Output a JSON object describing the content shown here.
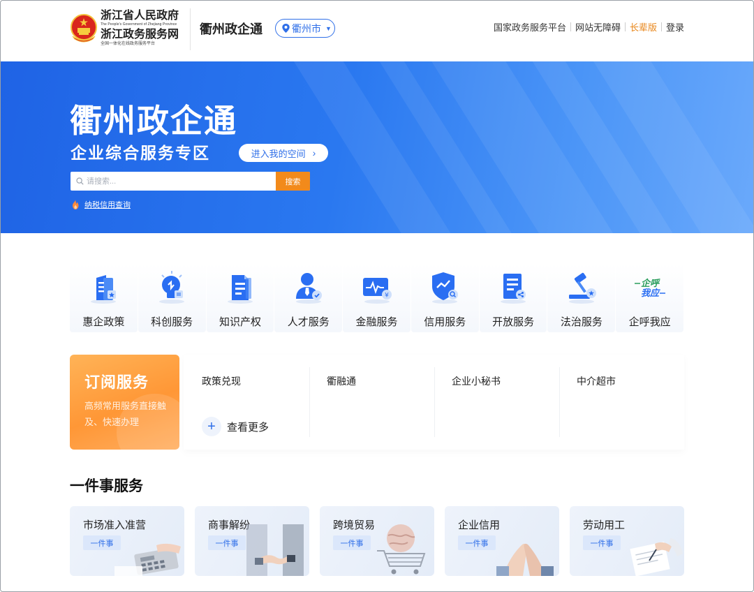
{
  "header": {
    "gov_title1": "浙江省人民政府",
    "gov_sub1": "The People's Government of Zhejiang Province",
    "gov_title2": "浙江政务服务网",
    "gov_sub2": "全国一体化在线政务服务平台",
    "site_name": "衢州政企通",
    "city": "衢州市",
    "links": {
      "national": "国家政务服务平台",
      "accessible": "网站无障碍",
      "elder": "长辈版",
      "login": "登录"
    }
  },
  "banner": {
    "title": "衢州政企通",
    "subtitle": "企业综合服务专区",
    "space_button": "进入我的空间",
    "search_placeholder": "请搜索...",
    "search_button": "搜索",
    "credit_link": "纳税信用查询"
  },
  "services": [
    {
      "label": "惠企政策",
      "icon": "policy-icon"
    },
    {
      "label": "科创服务",
      "icon": "innovation-icon"
    },
    {
      "label": "知识产权",
      "icon": "ip-icon"
    },
    {
      "label": "人才服务",
      "icon": "talent-icon"
    },
    {
      "label": "金融服务",
      "icon": "finance-icon"
    },
    {
      "label": "信用服务",
      "icon": "credit-icon"
    },
    {
      "label": "开放服务",
      "icon": "open-icon"
    },
    {
      "label": "法治服务",
      "icon": "law-icon"
    },
    {
      "label": "企呼我应",
      "icon": "qihu-woying-logo"
    }
  ],
  "subscription": {
    "title": "订阅服务",
    "desc": "高频常用服务直接触及、快速办理",
    "items": [
      "政策兑现",
      "衢融通",
      "企业小秘书",
      "中介超市"
    ],
    "more": "查看更多",
    "logo_text_1": "企呼",
    "logo_text_2": "我应"
  },
  "one_thing": {
    "title": "一件事服务",
    "cards": [
      {
        "title": "市场准入准营",
        "tag": "一件事"
      },
      {
        "title": "商事解纷",
        "tag": "一件事"
      },
      {
        "title": "跨境贸易",
        "tag": "一件事"
      },
      {
        "title": "企业信用",
        "tag": "一件事"
      },
      {
        "title": "劳动用工",
        "tag": "一件事"
      }
    ]
  },
  "colors": {
    "primary": "#2f6fe8",
    "accent_orange": "#f28a1b",
    "elder_orange": "#e8861a"
  }
}
